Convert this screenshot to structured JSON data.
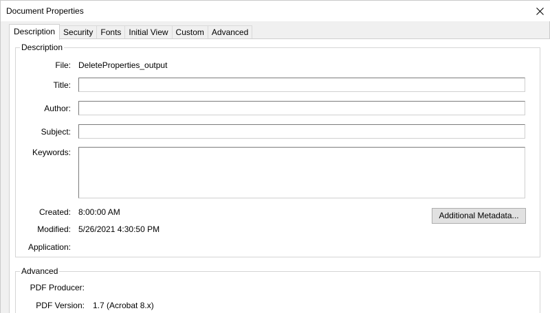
{
  "window": {
    "title": "Document Properties",
    "close_icon": "close-icon"
  },
  "tabs": [
    {
      "label": "Description",
      "active": true
    },
    {
      "label": "Security",
      "active": false
    },
    {
      "label": "Fonts",
      "active": false
    },
    {
      "label": "Initial View",
      "active": false
    },
    {
      "label": "Custom",
      "active": false
    },
    {
      "label": "Advanced",
      "active": false
    }
  ],
  "description": {
    "legend": "Description",
    "file_label": "File:",
    "file_value": "DeleteProperties_output",
    "title_label": "Title:",
    "title_value": "",
    "author_label": "Author:",
    "author_value": "",
    "subject_label": "Subject:",
    "subject_value": "",
    "keywords_label": "Keywords:",
    "keywords_value": "",
    "created_label": "Created:",
    "created_value": "8:00:00 AM",
    "modified_label": "Modified:",
    "modified_value": "5/26/2021 4:30:50 PM",
    "application_label": "Application:",
    "application_value": "",
    "metadata_button": "Additional Metadata..."
  },
  "advanced": {
    "legend": "Advanced",
    "producer_label": "PDF Producer:",
    "producer_value": "",
    "version_label": "PDF Version:",
    "version_value": "1.7 (Acrobat 8.x)"
  }
}
